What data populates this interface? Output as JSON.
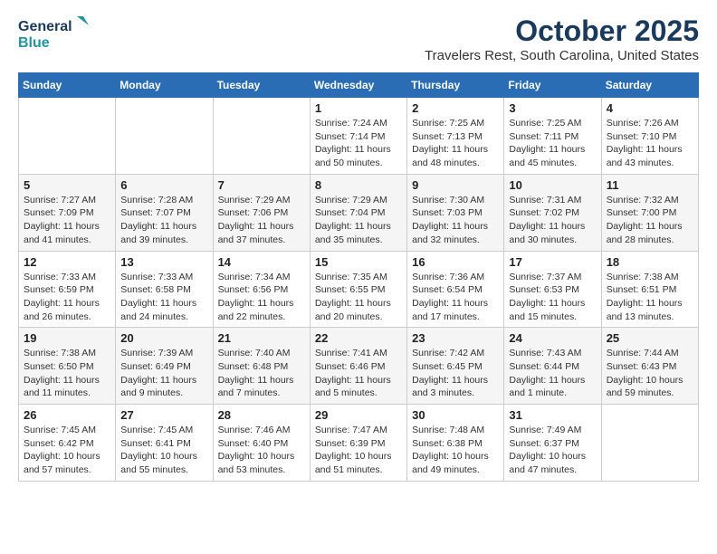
{
  "header": {
    "logo_line1": "General",
    "logo_line2": "Blue",
    "month": "October 2025",
    "location": "Travelers Rest, South Carolina, United States"
  },
  "weekdays": [
    "Sunday",
    "Monday",
    "Tuesday",
    "Wednesday",
    "Thursday",
    "Friday",
    "Saturday"
  ],
  "weeks": [
    [
      {
        "day": "",
        "info": ""
      },
      {
        "day": "",
        "info": ""
      },
      {
        "day": "",
        "info": ""
      },
      {
        "day": "1",
        "info": "Sunrise: 7:24 AM\nSunset: 7:14 PM\nDaylight: 11 hours\nand 50 minutes."
      },
      {
        "day": "2",
        "info": "Sunrise: 7:25 AM\nSunset: 7:13 PM\nDaylight: 11 hours\nand 48 minutes."
      },
      {
        "day": "3",
        "info": "Sunrise: 7:25 AM\nSunset: 7:11 PM\nDaylight: 11 hours\nand 45 minutes."
      },
      {
        "day": "4",
        "info": "Sunrise: 7:26 AM\nSunset: 7:10 PM\nDaylight: 11 hours\nand 43 minutes."
      }
    ],
    [
      {
        "day": "5",
        "info": "Sunrise: 7:27 AM\nSunset: 7:09 PM\nDaylight: 11 hours\nand 41 minutes."
      },
      {
        "day": "6",
        "info": "Sunrise: 7:28 AM\nSunset: 7:07 PM\nDaylight: 11 hours\nand 39 minutes."
      },
      {
        "day": "7",
        "info": "Sunrise: 7:29 AM\nSunset: 7:06 PM\nDaylight: 11 hours\nand 37 minutes."
      },
      {
        "day": "8",
        "info": "Sunrise: 7:29 AM\nSunset: 7:04 PM\nDaylight: 11 hours\nand 35 minutes."
      },
      {
        "day": "9",
        "info": "Sunrise: 7:30 AM\nSunset: 7:03 PM\nDaylight: 11 hours\nand 32 minutes."
      },
      {
        "day": "10",
        "info": "Sunrise: 7:31 AM\nSunset: 7:02 PM\nDaylight: 11 hours\nand 30 minutes."
      },
      {
        "day": "11",
        "info": "Sunrise: 7:32 AM\nSunset: 7:00 PM\nDaylight: 11 hours\nand 28 minutes."
      }
    ],
    [
      {
        "day": "12",
        "info": "Sunrise: 7:33 AM\nSunset: 6:59 PM\nDaylight: 11 hours\nand 26 minutes."
      },
      {
        "day": "13",
        "info": "Sunrise: 7:33 AM\nSunset: 6:58 PM\nDaylight: 11 hours\nand 24 minutes."
      },
      {
        "day": "14",
        "info": "Sunrise: 7:34 AM\nSunset: 6:56 PM\nDaylight: 11 hours\nand 22 minutes."
      },
      {
        "day": "15",
        "info": "Sunrise: 7:35 AM\nSunset: 6:55 PM\nDaylight: 11 hours\nand 20 minutes."
      },
      {
        "day": "16",
        "info": "Sunrise: 7:36 AM\nSunset: 6:54 PM\nDaylight: 11 hours\nand 17 minutes."
      },
      {
        "day": "17",
        "info": "Sunrise: 7:37 AM\nSunset: 6:53 PM\nDaylight: 11 hours\nand 15 minutes."
      },
      {
        "day": "18",
        "info": "Sunrise: 7:38 AM\nSunset: 6:51 PM\nDaylight: 11 hours\nand 13 minutes."
      }
    ],
    [
      {
        "day": "19",
        "info": "Sunrise: 7:38 AM\nSunset: 6:50 PM\nDaylight: 11 hours\nand 11 minutes."
      },
      {
        "day": "20",
        "info": "Sunrise: 7:39 AM\nSunset: 6:49 PM\nDaylight: 11 hours\nand 9 minutes."
      },
      {
        "day": "21",
        "info": "Sunrise: 7:40 AM\nSunset: 6:48 PM\nDaylight: 11 hours\nand 7 minutes."
      },
      {
        "day": "22",
        "info": "Sunrise: 7:41 AM\nSunset: 6:46 PM\nDaylight: 11 hours\nand 5 minutes."
      },
      {
        "day": "23",
        "info": "Sunrise: 7:42 AM\nSunset: 6:45 PM\nDaylight: 11 hours\nand 3 minutes."
      },
      {
        "day": "24",
        "info": "Sunrise: 7:43 AM\nSunset: 6:44 PM\nDaylight: 11 hours\nand 1 minute."
      },
      {
        "day": "25",
        "info": "Sunrise: 7:44 AM\nSunset: 6:43 PM\nDaylight: 10 hours\nand 59 minutes."
      }
    ],
    [
      {
        "day": "26",
        "info": "Sunrise: 7:45 AM\nSunset: 6:42 PM\nDaylight: 10 hours\nand 57 minutes."
      },
      {
        "day": "27",
        "info": "Sunrise: 7:45 AM\nSunset: 6:41 PM\nDaylight: 10 hours\nand 55 minutes."
      },
      {
        "day": "28",
        "info": "Sunrise: 7:46 AM\nSunset: 6:40 PM\nDaylight: 10 hours\nand 53 minutes."
      },
      {
        "day": "29",
        "info": "Sunrise: 7:47 AM\nSunset: 6:39 PM\nDaylight: 10 hours\nand 51 minutes."
      },
      {
        "day": "30",
        "info": "Sunrise: 7:48 AM\nSunset: 6:38 PM\nDaylight: 10 hours\nand 49 minutes."
      },
      {
        "day": "31",
        "info": "Sunrise: 7:49 AM\nSunset: 6:37 PM\nDaylight: 10 hours\nand 47 minutes."
      },
      {
        "day": "",
        "info": ""
      }
    ]
  ]
}
